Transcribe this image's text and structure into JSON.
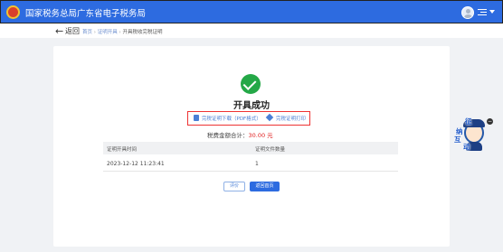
{
  "header": {
    "title": "国家税务总局广东省电子税务局",
    "logo_icon": "tax-emblem-icon",
    "user_icon": "user-avatar-icon",
    "menu_icon": "menu-icon",
    "brand_color": "#2d6be0"
  },
  "breadcrumb": {
    "back_label": "返回",
    "items": [
      "首页",
      "证明开具",
      "开具税收完税证明"
    ]
  },
  "result": {
    "title": "开具成功",
    "download_link": "完税证明下载（PDF格式）",
    "print_link": "完税证明打印",
    "total_label": "税费金额合计：",
    "total_value": "30.00 元"
  },
  "table": {
    "headers": [
      "证明开具时间",
      "证明文件数量"
    ],
    "rows": [
      [
        "2023-12-12 11:23:41",
        "1"
      ]
    ]
  },
  "buttons": {
    "evaluate": "评价",
    "home": "返回首页"
  },
  "assistant": {
    "chars": [
      "征",
      "纳",
      "互",
      "动"
    ],
    "close": "−"
  },
  "colors": {
    "success": "#24a847",
    "highlight_border": "#e33333",
    "amount": "#e02020",
    "link": "#4a7fd6"
  }
}
